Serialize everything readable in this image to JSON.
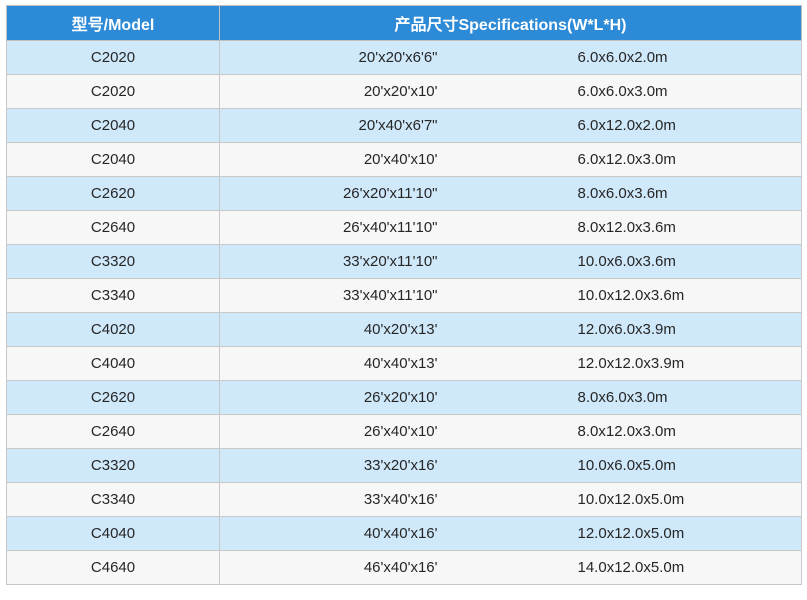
{
  "table": {
    "headers": {
      "model": "型号/Model",
      "spec": "产品尺寸Specifications(W*L*H)"
    },
    "rows": [
      {
        "model": "C2020",
        "imperial": "20'x20'x6'6\"",
        "metric": "6.0x6.0x2.0m"
      },
      {
        "model": "C2020",
        "imperial": "20'x20'x10'",
        "metric": "6.0x6.0x3.0m"
      },
      {
        "model": "C2040",
        "imperial": "20'x40'x6'7\"",
        "metric": "6.0x12.0x2.0m"
      },
      {
        "model": "C2040",
        "imperial": "20'x40'x10'",
        "metric": "6.0x12.0x3.0m"
      },
      {
        "model": "C2620",
        "imperial": "26'x20'x11'10\"",
        "metric": "8.0x6.0x3.6m"
      },
      {
        "model": "C2640",
        "imperial": "26'x40'x11'10\"",
        "metric": "8.0x12.0x3.6m"
      },
      {
        "model": "C3320",
        "imperial": "33'x20'x11'10\"",
        "metric": "10.0x6.0x3.6m"
      },
      {
        "model": "C3340",
        "imperial": "33'x40'x11'10\"",
        "metric": "10.0x12.0x3.6m"
      },
      {
        "model": "C4020",
        "imperial": "40'x20'x13'",
        "metric": "12.0x6.0x3.9m"
      },
      {
        "model": "C4040",
        "imperial": "40'x40'x13'",
        "metric": "12.0x12.0x3.9m"
      },
      {
        "model": "C2620",
        "imperial": "26'x20'x10'",
        "metric": "8.0x6.0x3.0m"
      },
      {
        "model": "C2640",
        "imperial": "26'x40'x10'",
        "metric": "8.0x12.0x3.0m"
      },
      {
        "model": "C3320",
        "imperial": "33'x20'x16'",
        "metric": "10.0x6.0x5.0m"
      },
      {
        "model": "C3340",
        "imperial": "33'x40'x16'",
        "metric": "10.0x12.0x5.0m"
      },
      {
        "model": "C4040",
        "imperial": "40'x40'x16'",
        "metric": "12.0x12.0x5.0m"
      },
      {
        "model": "C4640",
        "imperial": "46'x40'x16'",
        "metric": "14.0x12.0x5.0m"
      }
    ]
  },
  "colors": {
    "header_bg": "#2d8ad6",
    "row_blue": "#cfe8fa",
    "row_white": "#f7f7f7"
  }
}
